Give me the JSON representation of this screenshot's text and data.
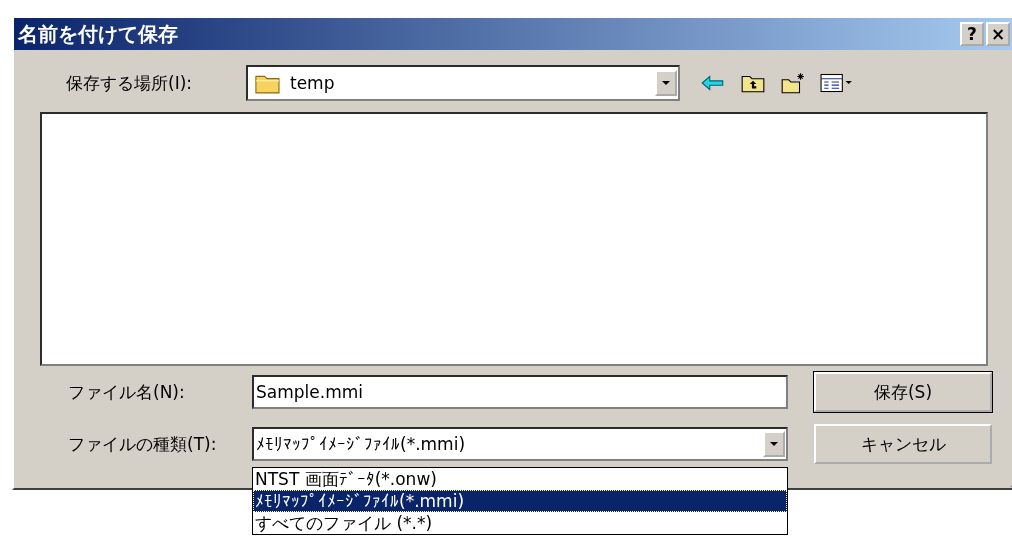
{
  "window": {
    "title": "名前を付けて保存",
    "title_buttons": [
      "?",
      "×"
    ]
  },
  "save_in": {
    "label": "保存する場所(I):",
    "value": "temp"
  },
  "file_name": {
    "label": "ファイル名(N):",
    "value": "Sample.mmi"
  },
  "file_type": {
    "label": "ファイルの種類(T):",
    "value": "ﾒﾓﾘﾏｯﾌﾟｲﾒｰｼﾞﾌｧｲﾙ(*.mmi)",
    "expanded": true,
    "options": [
      {
        "label": "NTST 画面ﾃﾞｰﾀ(*.onw)",
        "selected": false
      },
      {
        "label": "ﾒﾓﾘﾏｯﾌﾟｲﾒｰｼﾞﾌｧｲﾙ(*.mmi)",
        "selected": true
      },
      {
        "label": "すべてのファイル (*.*)",
        "selected": false
      }
    ]
  },
  "buttons": [
    {
      "label": "保存(S)",
      "kind": "default"
    },
    {
      "label": "キャンセル",
      "kind": "normal"
    }
  ]
}
